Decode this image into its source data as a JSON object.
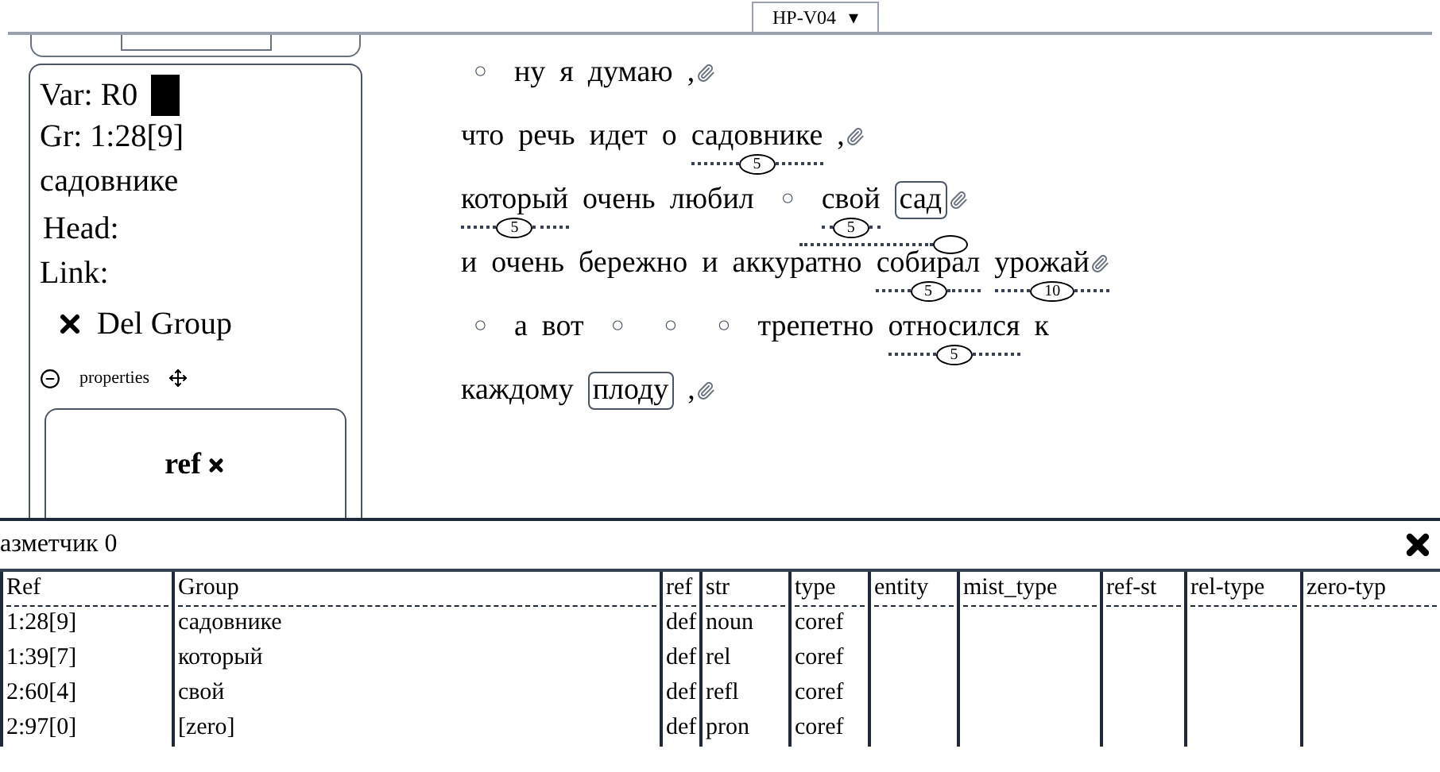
{
  "top_select": {
    "value": "НР-V04",
    "caret": "▾"
  },
  "group_card": {
    "var_label": "Var: R0",
    "group": "Gr: 1:28[9]",
    "word": "садовнике",
    "head": "Head:",
    "link": "Link:",
    "delete": "Del Group",
    "properties": "properties",
    "ref_card": {
      "title": "ref"
    }
  },
  "text_lines": [
    [
      {
        "kind": "circle",
        "text": "○"
      },
      {
        "kind": "word",
        "text": "ну"
      },
      {
        "kind": "word",
        "text": "я"
      },
      {
        "kind": "word",
        "text": "думаю"
      },
      {
        "kind": "word",
        "text": ",",
        "clip": true
      }
    ],
    [
      {
        "kind": "word",
        "text": "что"
      },
      {
        "kind": "word",
        "text": "речь"
      },
      {
        "kind": "word",
        "text": "идет"
      },
      {
        "kind": "word",
        "text": "о"
      },
      {
        "kind": "word",
        "text": "садовнике",
        "mark": "5"
      },
      {
        "kind": "word",
        "text": ",",
        "clip": true
      }
    ],
    [
      {
        "kind": "word",
        "text": "который",
        "mark": "5"
      },
      {
        "kind": "word",
        "text": "очень"
      },
      {
        "kind": "word",
        "text": "любил"
      },
      {
        "kind": "circle",
        "text": "○"
      },
      {
        "kind": "word",
        "text": "свой",
        "mark": "5"
      },
      {
        "kind": "boxed",
        "text": "сад",
        "clip": true,
        "link": true
      }
    ],
    [
      {
        "kind": "word",
        "text": "и"
      },
      {
        "kind": "word",
        "text": "очень"
      },
      {
        "kind": "word",
        "text": "бережно"
      },
      {
        "kind": "word",
        "text": "и"
      },
      {
        "kind": "word",
        "text": "аккуратно"
      },
      {
        "kind": "word",
        "text": "собирал",
        "mark": "5"
      },
      {
        "kind": "word",
        "text": "урожай",
        "mark": "10",
        "clip": true
      }
    ],
    [
      {
        "kind": "circle",
        "text": "○"
      },
      {
        "kind": "word",
        "text": "а"
      },
      {
        "kind": "word",
        "text": "вот"
      },
      {
        "kind": "circle",
        "text": "○"
      },
      {
        "kind": "circle",
        "text": "○"
      },
      {
        "kind": "circle",
        "text": "○"
      },
      {
        "kind": "word",
        "text": "трепетно"
      },
      {
        "kind": "word",
        "text": "относился",
        "mark": "5"
      },
      {
        "kind": "word",
        "text": "к"
      }
    ],
    [
      {
        "kind": "word",
        "text": "каждому"
      },
      {
        "kind": "boxed",
        "text": "плоду"
      },
      {
        "kind": "word",
        "text": ",",
        "clip": true
      }
    ]
  ],
  "annotator_panel": {
    "title": "азметчик 0"
  },
  "table": {
    "columns": [
      "Ref",
      "Group",
      "ref",
      "str",
      "type",
      "entity",
      "mist_type",
      "ref-st",
      "rel-type",
      "zero-typ"
    ],
    "rows": [
      [
        "1:28[9]",
        "садовнике",
        "def",
        "noun",
        "coref"
      ],
      [
        "1:39[7]",
        "который",
        "def",
        "rel",
        "coref"
      ],
      [
        "2:60[4]",
        "свой",
        "def",
        "refl",
        "coref"
      ],
      [
        "2:97[0]",
        "[zero]",
        "def",
        "pron",
        "coref"
      ]
    ]
  }
}
